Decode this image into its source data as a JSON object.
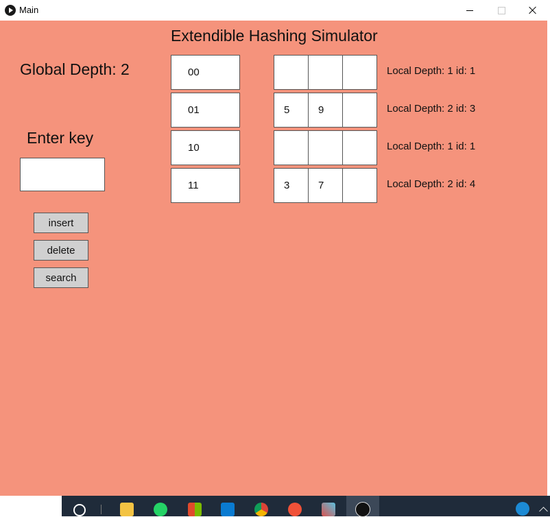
{
  "window": {
    "title": "Main"
  },
  "colors": {
    "canvas": "#f5937c",
    "button": "#d0d0d0",
    "taskbar": "#1f2b3a"
  },
  "app": {
    "heading": "Extendible Hashing Simulator",
    "global_depth": "Global Depth: 2",
    "enter_key_label": "Enter key",
    "key_input_value": ""
  },
  "buttons": {
    "insert": "insert",
    "delete": "delete",
    "search": "search"
  },
  "directory": [
    {
      "index": "00",
      "slots": [
        "",
        "",
        ""
      ],
      "info": "Local Depth: 1 id: 1"
    },
    {
      "index": "01",
      "slots": [
        "5",
        "9",
        ""
      ],
      "info": "Local Depth: 2 id: 3"
    },
    {
      "index": "10",
      "slots": [
        "",
        "",
        ""
      ],
      "info": "Local Depth: 1 id: 1"
    },
    {
      "index": "11",
      "slots": [
        "3",
        "7",
        ""
      ],
      "info": "Local Depth: 2 id: 4"
    }
  ],
  "taskbar": {
    "icons": [
      "cortana-icon",
      "file-explorer-icon",
      "whatsapp-icon",
      "office-icon",
      "vscode-icon",
      "chrome-icon",
      "swift-icon",
      "tool-icon",
      "app-run-icon",
      "help-icon",
      "chevron-up-icon"
    ]
  }
}
